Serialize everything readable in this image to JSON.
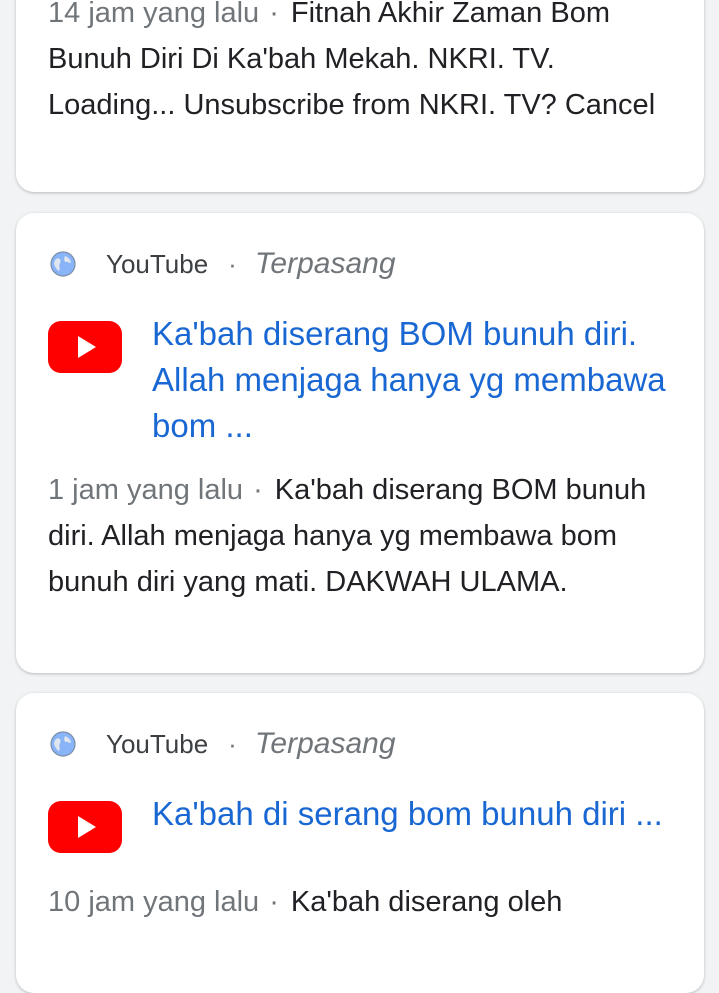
{
  "colors": {
    "link": "#1967d2",
    "meta_gray": "#70757a",
    "text": "#202124",
    "youtube_red": "#ff0000",
    "globe_blue": "#8ab4f8"
  },
  "cards": [
    {
      "time": "14 jam yang lalu",
      "separator": "·",
      "snippet": "Fitnah Akhir Zaman Bom Bunuh Diri Di Ka'bah Mekah. NKRI. TV. Loading... Unsubscribe from NKRI. TV? Cancel"
    },
    {
      "source_icon": "globe-icon",
      "source": "YouTube",
      "separator": "·",
      "installed": "Terpasang",
      "app_icon": "youtube-icon",
      "title": "Ka'bah diserang BOM bunuh diri. Allah menjaga hanya yg membawa bom ...",
      "time": "1 jam yang lalu",
      "snippet": "Ka'bah diserang BOM bunuh diri. Allah menjaga hanya yg membawa bom bunuh diri yang mati. DAKWAH ULAMA."
    },
    {
      "source_icon": "globe-icon",
      "source": "YouTube",
      "separator": "·",
      "installed": "Terpasang",
      "app_icon": "youtube-icon",
      "title": "Ka'bah di serang bom bunuh diri ...",
      "time": "10 jam yang lalu",
      "snippet": "Ka'bah diserang oleh"
    }
  ]
}
